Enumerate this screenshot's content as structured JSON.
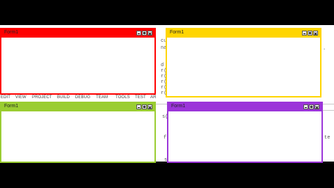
{
  "colors": {
    "red": "#ff0000",
    "yellow": "#ffd500",
    "green": "#9acd32",
    "purple": "#9b35d9"
  },
  "forms": [
    {
      "title": "Form1"
    },
    {
      "title": "Form1"
    },
    {
      "title": "Form1"
    },
    {
      "title": "Form1"
    }
  ],
  "menu": [
    "EDIT",
    "VIEW",
    "PROJECT",
    "BUILD",
    "DEBUG",
    "TEAM",
    "TOOLS",
    "TEST",
    "AR"
  ],
  "code_fragments": {
    "left_col": [
      "cu",
      "na",
      "",
      "",
      "d",
      "r(",
      "r(",
      "r(",
      "r(",
      "r("
    ],
    "right_edge": [
      ".",
      "te"
    ],
    "after_menu": [
      "s(",
      "",
      "",
      "f",
      "",
      "",
      "",
      "",
      "s"
    ]
  }
}
